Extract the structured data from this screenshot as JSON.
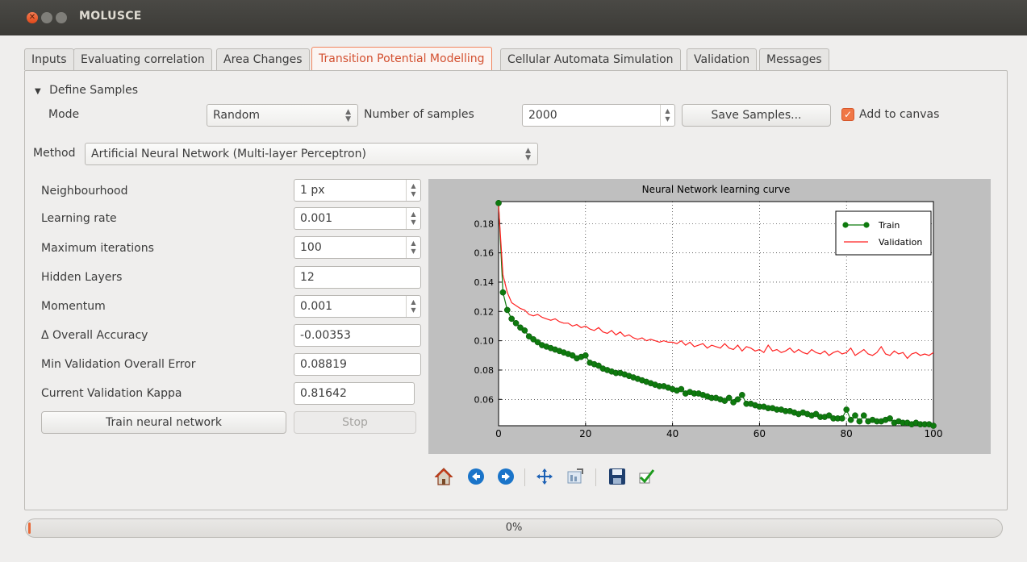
{
  "window": {
    "title": "MOLUSCE"
  },
  "tabs": [
    {
      "label": "Inputs"
    },
    {
      "label": "Evaluating correlation"
    },
    {
      "label": "Area Changes"
    },
    {
      "label": "Transition Potential Modelling"
    },
    {
      "label": "Cellular Automata Simulation"
    },
    {
      "label": "Validation"
    },
    {
      "label": "Messages"
    }
  ],
  "samples": {
    "section_label": "Define Samples",
    "mode_label": "Mode",
    "mode_value": "Random",
    "count_label": "Number of samples",
    "count_value": "2000",
    "save_button": "Save Samples...",
    "add_to_canvas_label": "Add to canvas",
    "add_to_canvas_checked": true
  },
  "method": {
    "label": "Method",
    "value": "Artificial Neural Network (Multi-layer Perceptron)"
  },
  "params": {
    "neighbourhood_label": "Neighbourhood",
    "neighbourhood_value": "1 px",
    "learning_rate_label": "Learning rate",
    "learning_rate_value": "0.001",
    "max_iter_label": "Maximum iterations",
    "max_iter_value": "100",
    "hidden_layers_label": "Hidden Layers",
    "hidden_layers_value": "12",
    "momentum_label": "Momentum",
    "momentum_value": "0.001",
    "delta_acc_label": "Δ Overall Accuracy",
    "delta_acc_value": "-0.00353",
    "min_val_err_label": "Min Validation Overall Error",
    "min_val_err_value": "0.08819",
    "kappa_label": "Current Validation Kappa",
    "kappa_value": "0.81642",
    "train_button": "Train neural network",
    "stop_button": "Stop"
  },
  "plot_toolbar": {
    "icons": [
      "home-icon",
      "back-icon",
      "forward-icon",
      "pan-icon",
      "configure-subplots-icon",
      "save-figure-icon",
      "apply-icon"
    ]
  },
  "progress": {
    "text": "0%",
    "value": 0.0
  },
  "colors": {
    "accent": "#f07746",
    "train": "#0e7a0e",
    "validation": "#ff2020"
  },
  "chart_data": {
    "type": "line",
    "title": "Neural Network learning curve",
    "xlim": [
      0,
      100
    ],
    "ylim": [
      0.042,
      0.195
    ],
    "xticks": [
      0,
      20,
      40,
      60,
      80,
      100
    ],
    "yticks": [
      0.06,
      0.08,
      0.1,
      0.12,
      0.14,
      0.16,
      0.18
    ],
    "grid": true,
    "legend_position": "top-right",
    "series": [
      {
        "name": "Train",
        "style": "line-with-markers",
        "color": "#0e7a0e",
        "x": [
          0,
          1,
          2,
          3,
          4,
          5,
          6,
          7,
          8,
          9,
          10,
          11,
          12,
          13,
          14,
          15,
          16,
          17,
          18,
          19,
          20,
          21,
          22,
          23,
          24,
          25,
          26,
          27,
          28,
          29,
          30,
          31,
          32,
          33,
          34,
          35,
          36,
          37,
          38,
          39,
          40,
          41,
          42,
          43,
          44,
          45,
          46,
          47,
          48,
          49,
          50,
          51,
          52,
          53,
          54,
          55,
          56,
          57,
          58,
          59,
          60,
          61,
          62,
          63,
          64,
          65,
          66,
          67,
          68,
          69,
          70,
          71,
          72,
          73,
          74,
          75,
          76,
          77,
          78,
          79,
          80,
          81,
          82,
          83,
          84,
          85,
          86,
          87,
          88,
          89,
          90,
          91,
          92,
          93,
          94,
          95,
          96,
          97,
          98,
          99,
          100
        ],
        "y": [
          0.194,
          0.133,
          0.121,
          0.115,
          0.112,
          0.109,
          0.107,
          0.103,
          0.101,
          0.099,
          0.097,
          0.096,
          0.095,
          0.094,
          0.093,
          0.092,
          0.091,
          0.09,
          0.088,
          0.089,
          0.09,
          0.085,
          0.084,
          0.083,
          0.081,
          0.08,
          0.079,
          0.078,
          0.078,
          0.077,
          0.076,
          0.075,
          0.074,
          0.073,
          0.072,
          0.071,
          0.07,
          0.069,
          0.069,
          0.068,
          0.067,
          0.066,
          0.067,
          0.064,
          0.065,
          0.064,
          0.064,
          0.063,
          0.062,
          0.061,
          0.061,
          0.06,
          0.059,
          0.061,
          0.058,
          0.06,
          0.063,
          0.057,
          0.057,
          0.056,
          0.055,
          0.055,
          0.054,
          0.054,
          0.053,
          0.053,
          0.052,
          0.052,
          0.051,
          0.05,
          0.051,
          0.05,
          0.049,
          0.05,
          0.048,
          0.048,
          0.049,
          0.047,
          0.047,
          0.047,
          0.053,
          0.046,
          0.049,
          0.045,
          0.049,
          0.045,
          0.046,
          0.045,
          0.045,
          0.046,
          0.047,
          0.044,
          0.045,
          0.044,
          0.044,
          0.043,
          0.044,
          0.043,
          0.043,
          0.043,
          0.042
        ]
      },
      {
        "name": "Validation",
        "style": "line",
        "color": "#ff2020",
        "x": [
          0,
          1,
          2,
          3,
          4,
          5,
          6,
          7,
          8,
          9,
          10,
          11,
          12,
          13,
          14,
          15,
          16,
          17,
          18,
          19,
          20,
          21,
          22,
          23,
          24,
          25,
          26,
          27,
          28,
          29,
          30,
          31,
          32,
          33,
          34,
          35,
          36,
          37,
          38,
          39,
          40,
          41,
          42,
          43,
          44,
          45,
          46,
          47,
          48,
          49,
          50,
          51,
          52,
          53,
          54,
          55,
          56,
          57,
          58,
          59,
          60,
          61,
          62,
          63,
          64,
          65,
          66,
          67,
          68,
          69,
          70,
          71,
          72,
          73,
          74,
          75,
          76,
          77,
          78,
          79,
          80,
          81,
          82,
          83,
          84,
          85,
          86,
          87,
          88,
          89,
          90,
          91,
          92,
          93,
          94,
          95,
          96,
          97,
          98,
          99,
          100
        ],
        "y": [
          0.192,
          0.145,
          0.133,
          0.126,
          0.124,
          0.122,
          0.121,
          0.118,
          0.117,
          0.118,
          0.116,
          0.115,
          0.114,
          0.115,
          0.113,
          0.112,
          0.112,
          0.11,
          0.111,
          0.109,
          0.11,
          0.108,
          0.107,
          0.109,
          0.106,
          0.105,
          0.107,
          0.104,
          0.106,
          0.103,
          0.104,
          0.102,
          0.101,
          0.102,
          0.1,
          0.101,
          0.1,
          0.099,
          0.1,
          0.099,
          0.099,
          0.098,
          0.1,
          0.097,
          0.099,
          0.096,
          0.097,
          0.098,
          0.095,
          0.097,
          0.096,
          0.095,
          0.098,
          0.095,
          0.094,
          0.097,
          0.093,
          0.096,
          0.095,
          0.093,
          0.094,
          0.092,
          0.097,
          0.093,
          0.094,
          0.092,
          0.093,
          0.095,
          0.092,
          0.094,
          0.092,
          0.091,
          0.094,
          0.092,
          0.091,
          0.093,
          0.09,
          0.092,
          0.093,
          0.091,
          0.092,
          0.095,
          0.09,
          0.092,
          0.094,
          0.091,
          0.09,
          0.092,
          0.096,
          0.091,
          0.09,
          0.093,
          0.091,
          0.092,
          0.088,
          0.091,
          0.092,
          0.09,
          0.091,
          0.09,
          0.092
        ]
      }
    ]
  }
}
